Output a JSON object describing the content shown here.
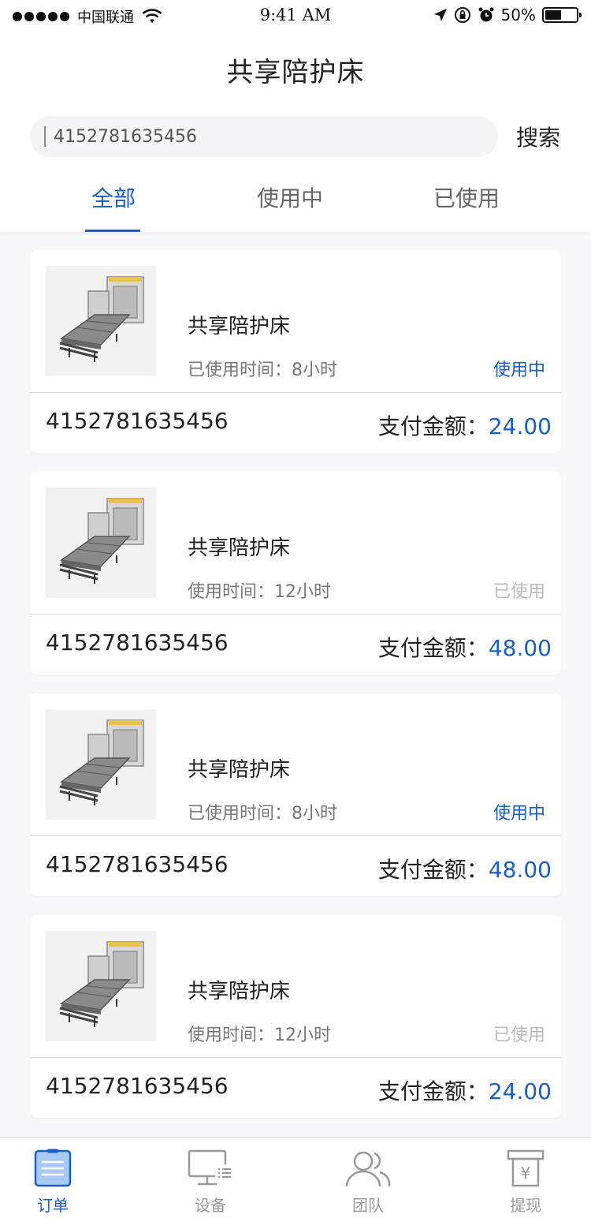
{
  "status_bar": {
    "carrier": "中国联通",
    "time": "9:41 AM",
    "battery": "50%",
    "battery_level": 0.5
  },
  "header": {
    "title": "共享陪护床",
    "search": {
      "value": "4152781635456",
      "button_label": "搜索"
    },
    "tabs": [
      {
        "label": "全部",
        "active": true
      },
      {
        "label": "使用中",
        "active": false
      },
      {
        "label": "已使用",
        "active": false
      }
    ]
  },
  "orders": [
    {
      "name": "共享陪护床",
      "time_label": "已使用时间：8小时",
      "status": "使用中",
      "status_type": "active",
      "order_no": "4152781635456",
      "pay_label": "支付金额：",
      "amount": "24.00"
    },
    {
      "name": "共享陪护床",
      "time_label": "使用时间：12小时",
      "status": "已使用",
      "status_type": "used",
      "order_no": "4152781635456",
      "pay_label": "支付金额：",
      "amount": "48.00"
    },
    {
      "name": "共享陪护床",
      "time_label": "已使用时间：8小时",
      "status": "使用中",
      "status_type": "active",
      "order_no": "4152781635456",
      "pay_label": "支付金额：",
      "amount": "48.00"
    },
    {
      "name": "共享陪护床",
      "time_label": "使用时间：12小时",
      "status": "已使用",
      "status_type": "used",
      "order_no": "4152781635456",
      "pay_label": "支付金额：",
      "amount": "24.00"
    }
  ],
  "tabbar": {
    "items": [
      {
        "label": "订单",
        "icon": "order-icon",
        "active": true
      },
      {
        "label": "设备",
        "icon": "device-icon",
        "active": false
      },
      {
        "label": "团队",
        "icon": "team-icon",
        "active": false
      },
      {
        "label": "提现",
        "icon": "withdraw-icon",
        "active": false
      }
    ]
  },
  "colors": {
    "accent": "#1a5fc4",
    "used": "#bbbbbb"
  }
}
